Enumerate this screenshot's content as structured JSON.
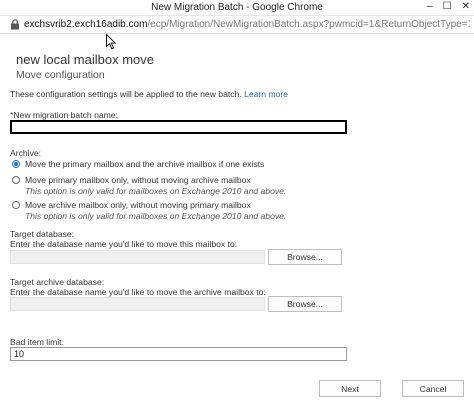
{
  "window": {
    "title": "New Migration Batch - Google Chrome",
    "controls": {
      "minimize": "–",
      "maximize": "☐",
      "close": "✕"
    }
  },
  "address_bar": {
    "host": "exchsvrib2.exch16adib.com",
    "path": "/ecp/Migration/NewMigrationBatch.aspx?pwmcid=1&ReturnObjectType=1&dtm=..."
  },
  "page": {
    "title": "new local mailbox move",
    "subtitle": "Move configuration",
    "info_text": "These configuration settings will be applied to the new batch.",
    "learn_more": "Learn more",
    "batch_name": {
      "label": "*New migration batch name:",
      "value": ""
    },
    "archive": {
      "label": "Archive:",
      "options": [
        {
          "label": "Move the primary mailbox and the archive mailbox if one exists",
          "note": "",
          "checked": true
        },
        {
          "label": "Move primary mailbox only, without moving archive mailbox",
          "note": "This option is only valid for mailboxes on Exchange 2010 and above.",
          "checked": false
        },
        {
          "label": "Move archive mailbox only, without moving primary mailbox",
          "note": "This option is only valid for mailboxes on Exchange 2010 and above.",
          "checked": false
        }
      ]
    },
    "target_db": {
      "label": "Target database:",
      "hint": "Enter the database name you'd like to move this mailbox to:",
      "value": "",
      "browse": "Browse..."
    },
    "target_archive_db": {
      "label": "Target archive database:",
      "hint": "Enter the database name you'd like to move the archive mailbox to:",
      "value": "",
      "browse": "Browse..."
    },
    "bad_item_limit": {
      "label": "Bad item limit:",
      "value": "10"
    },
    "buttons": {
      "next": "Next",
      "cancel": "Cancel"
    }
  }
}
